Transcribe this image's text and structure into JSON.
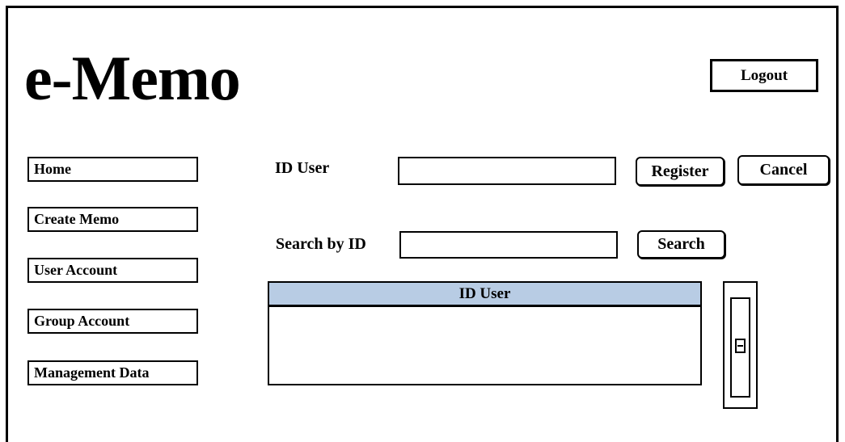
{
  "app": {
    "logo": "e-Memo"
  },
  "header": {
    "logout_label": "Logout"
  },
  "sidebar": {
    "items": [
      {
        "label": "Home"
      },
      {
        "label": "Create Memo"
      },
      {
        "label": "User Account"
      },
      {
        "label": "Group Account"
      },
      {
        "label": "Management Data"
      }
    ]
  },
  "form": {
    "id_user_label": "ID User",
    "id_user_value": "",
    "register_label": "Register",
    "cancel_label": "Cancel",
    "search_label": "Search by ID",
    "search_value": "",
    "search_button_label": "Search"
  },
  "table": {
    "columns": [
      "ID User"
    ],
    "rows": [],
    "header_color": "#b8cce4"
  }
}
